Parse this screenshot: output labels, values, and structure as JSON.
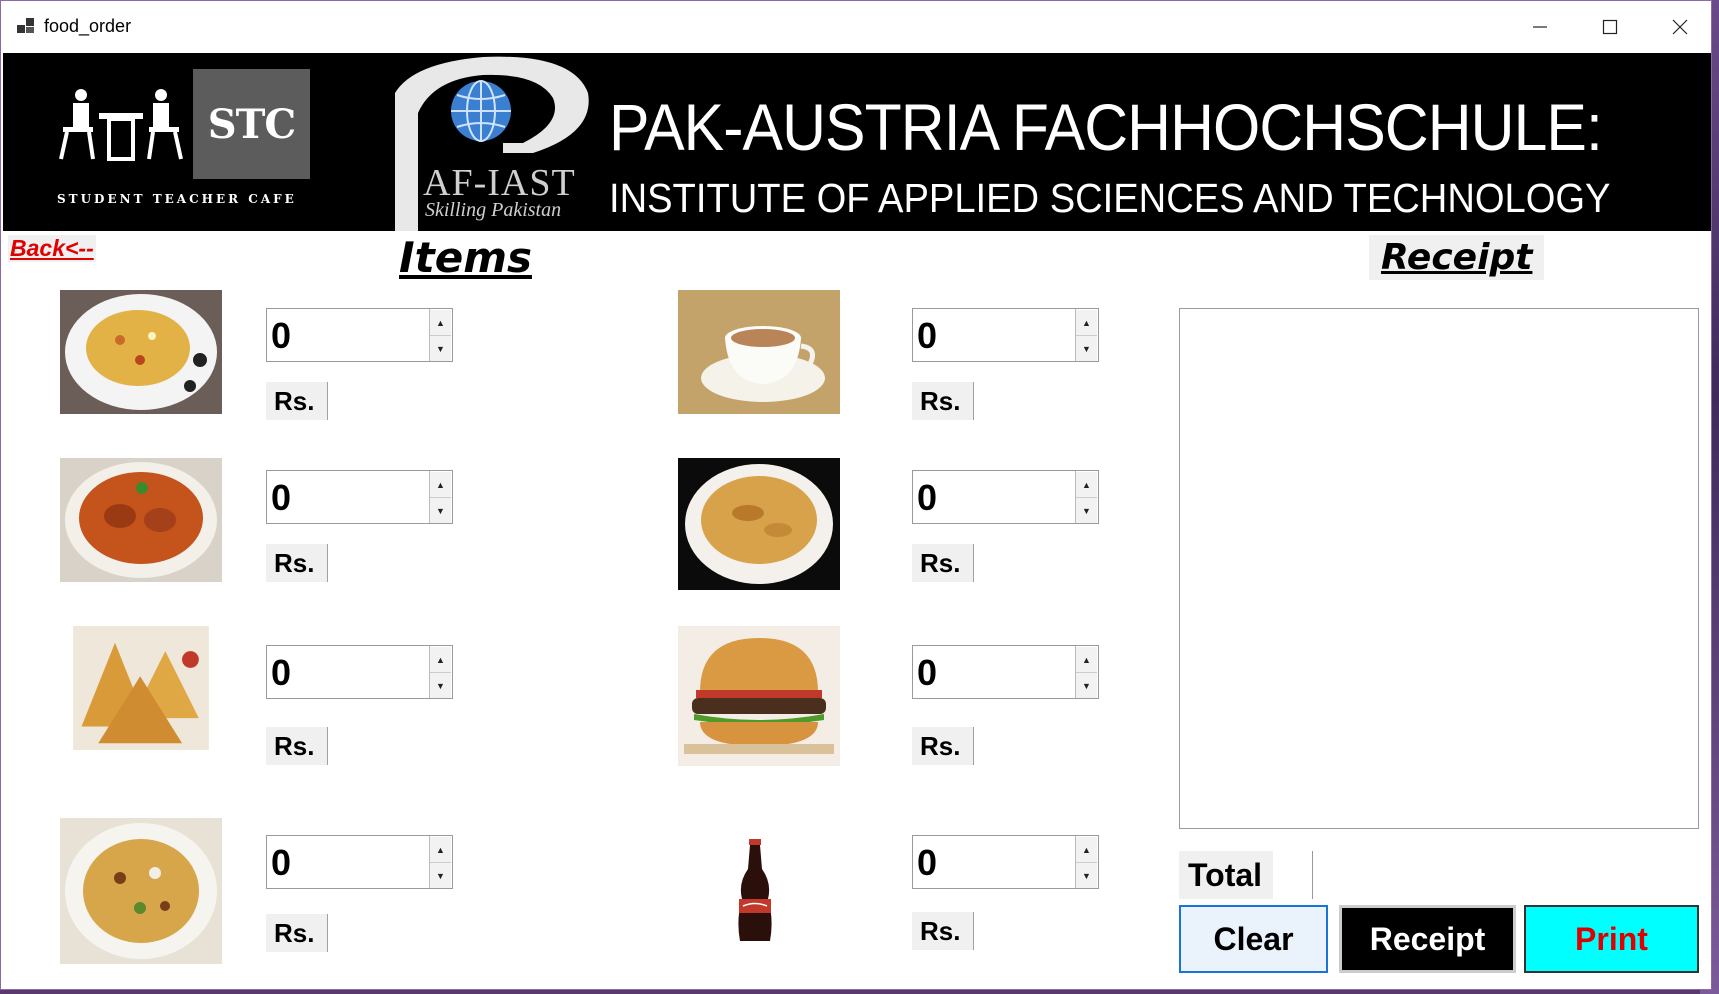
{
  "window": {
    "title": "food_order"
  },
  "banner": {
    "stc_logo_text": "STC",
    "stc_caption": "STUDENT TEACHER CAFE",
    "afiast_text": "AF-IAST",
    "afiast_sub": "Skilling Pakistan",
    "university_line1": "PAK-AUSTRIA FACHHOCHSCHULE:",
    "university_line2": "INSTITUTE OF APPLIED SCIENCES AND TECHNOLOGY"
  },
  "back_link": "Back<--",
  "items_heading": "Items",
  "receipt_heading": "Receipt",
  "items": [
    {
      "icon": "biryani-image",
      "quantity": "0",
      "price_label": "Rs."
    },
    {
      "icon": "chicken-curry-image",
      "quantity": "0",
      "price_label": "Rs."
    },
    {
      "icon": "samosa-image",
      "quantity": "0",
      "price_label": "Rs."
    },
    {
      "icon": "chaat-image",
      "quantity": "0",
      "price_label": "Rs."
    },
    {
      "icon": "tea-image",
      "quantity": "0",
      "price_label": "Rs."
    },
    {
      "icon": "paratha-image",
      "quantity": "0",
      "price_label": "Rs."
    },
    {
      "icon": "burger-image",
      "quantity": "0",
      "price_label": "Rs."
    },
    {
      "icon": "cola-bottle-image",
      "quantity": "0",
      "price_label": "Rs."
    }
  ],
  "receipt_text": "",
  "total_label": "Total",
  "total_value": "",
  "buttons": {
    "clear": "Clear",
    "receipt": "Receipt",
    "print": "Print"
  },
  "colors": {
    "print_bg": "#00ffff",
    "print_text": "#e00000",
    "receipt_btn_bg": "#000000",
    "back_link": "#e00000"
  }
}
